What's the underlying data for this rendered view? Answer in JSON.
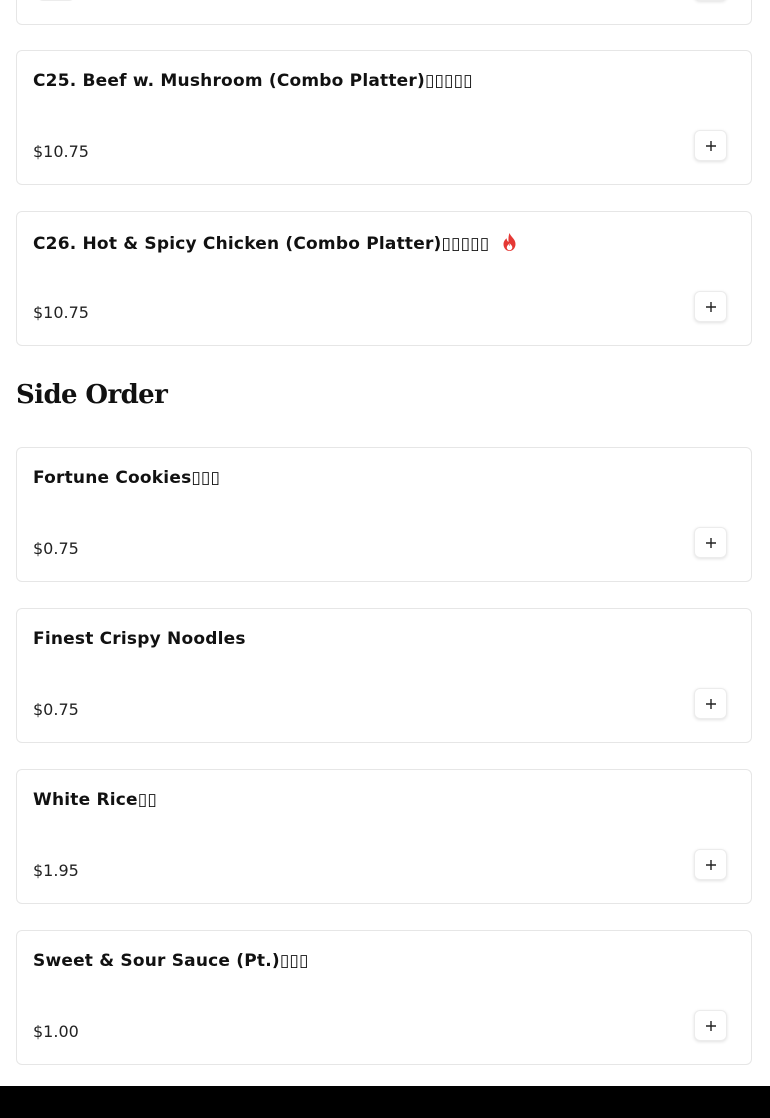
{
  "sections": [
    {
      "items": [
        {
          "name": "C25. Beef w. Mushroom (Combo Platter)▯▯▯▯▯",
          "price": "$10.75",
          "spicy": false
        },
        {
          "name": "C26. Hot & Spicy Chicken (Combo Platter)▯▯▯▯▯",
          "price": "$10.75",
          "spicy": true
        }
      ]
    },
    {
      "heading": "Side Order",
      "items": [
        {
          "name": "Fortune Cookies▯▯▯",
          "price": "$0.75",
          "spicy": false
        },
        {
          "name": "Finest Crispy Noodles",
          "price": "$0.75",
          "spicy": false
        },
        {
          "name": "White Rice▯▯",
          "price": "$1.95",
          "spicy": false
        },
        {
          "name": "Sweet & Sour Sauce (Pt.)▯▯▯",
          "price": "$1.00",
          "spicy": false
        }
      ]
    }
  ],
  "icons": {
    "add": "plus-icon",
    "spicy": "flame-icon"
  },
  "colors": {
    "spicy": "#e53935",
    "card_border": "#e6e6e6",
    "footer": "#000000"
  }
}
